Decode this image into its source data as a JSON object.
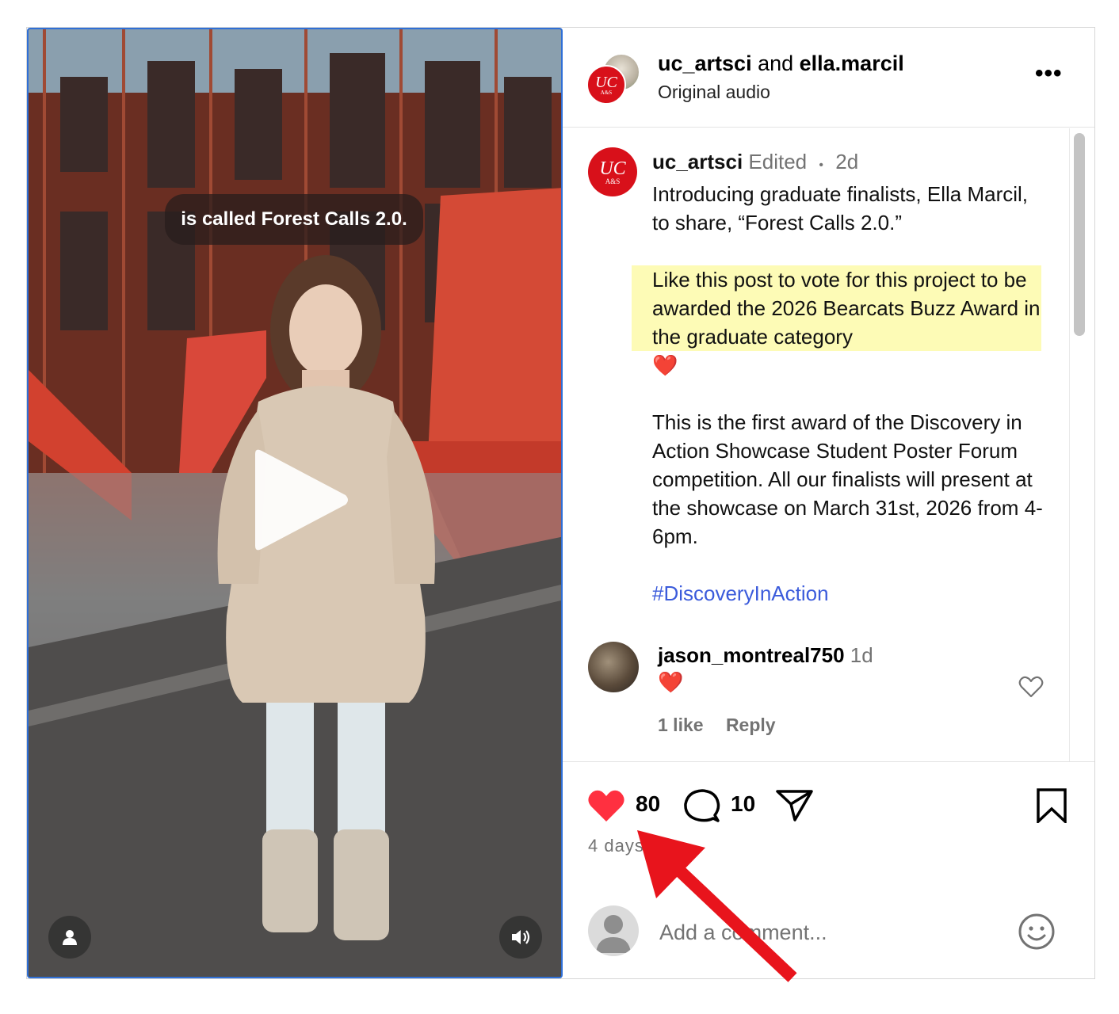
{
  "video": {
    "caption": "is called Forest Calls 2.0.",
    "play_icon": "play-icon",
    "user_icon": "user-icon",
    "sound_icon": "volume-icon"
  },
  "header": {
    "user1": "uc_artsci",
    "connector": " and ",
    "user2": "ella.marcil",
    "subtitle": "Original audio",
    "more": "•••"
  },
  "caption_post": {
    "username": "uc_artsci",
    "edited": "Edited",
    "dot": "•",
    "time": "2d",
    "para1": "Introducing graduate finalists, Ella Marcil, to share, “Forest Calls 2.0.”",
    "highlight": "Like this post to vote for this project to be awarded the 2026 Bearcats Buzz Award in the graduate category",
    "heart": "❤️",
    "para2": "This is the first award of the Discovery in Action Showcase Student Poster Forum competition. All our finalists will present at the showcase on March 31st, 2026 from 4-6pm.",
    "hashtag": "#DiscoveryInAction"
  },
  "comment": {
    "username": "jason_montreal750",
    "time": "1d",
    "text": "❤️",
    "likes": "1 like",
    "reply": "Reply"
  },
  "actions": {
    "likes": "80",
    "comments": "10",
    "date": "4 days"
  },
  "add_comment": {
    "placeholder": "Add a comment..."
  },
  "colors": {
    "uc_red": "#d8101a",
    "like_red": "#ff3040",
    "hashtag_blue": "#3b5bdb",
    "highlight_yellow": "#fdfbb6",
    "arrow_red": "#e8141c"
  }
}
